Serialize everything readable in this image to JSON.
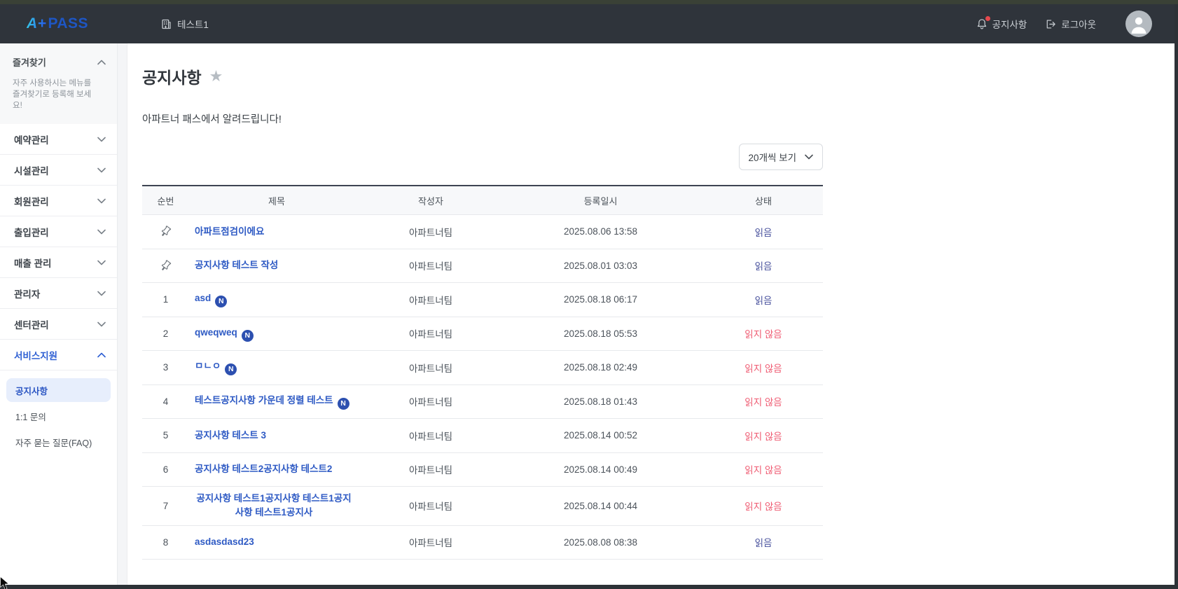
{
  "topbar": {
    "logo_a": "A+",
    "logo_pass": "PASS",
    "site_tab": "테스트1",
    "notice_label": "공지사항",
    "logout_label": "로그아웃"
  },
  "sidebar": {
    "favorites": {
      "title": "즐겨찾기",
      "description": "자주 사용하시는 메뉴를 즐겨찾기로 등록해 보세요!"
    },
    "menus": [
      {
        "label": "예약관리",
        "expanded": false
      },
      {
        "label": "시설관리",
        "expanded": false
      },
      {
        "label": "회원관리",
        "expanded": false
      },
      {
        "label": "출입관리",
        "expanded": false
      },
      {
        "label": "매출 관리",
        "expanded": false
      },
      {
        "label": "관리자",
        "expanded": false
      },
      {
        "label": "센터관리",
        "expanded": false
      },
      {
        "label": "서비스지원",
        "expanded": true
      }
    ],
    "submenu": [
      {
        "label": "공지사항",
        "active": true
      },
      {
        "label": "1:1 문의",
        "active": false
      },
      {
        "label": "자주 묻는 질문(FAQ)",
        "active": false
      }
    ]
  },
  "main": {
    "title": "공지사항",
    "subtitle": "아파트너 패스에서 알려드립니다!",
    "page_size_select": "20개씩 보기",
    "table": {
      "headers": [
        "순번",
        "제목",
        "작성자",
        "등록일시",
        "상태"
      ],
      "rows": [
        {
          "no": "",
          "pinned": true,
          "title": "아파트점검이에요",
          "new": false,
          "author": "아파트너팀",
          "date": "2025.08.06 13:58",
          "status": "읽음",
          "read": true
        },
        {
          "no": "",
          "pinned": true,
          "title": "공지사항 테스트 작성",
          "new": false,
          "author": "아파트너팀",
          "date": "2025.08.01 03:03",
          "status": "읽음",
          "read": true
        },
        {
          "no": "1",
          "pinned": false,
          "title": "asd",
          "new": true,
          "author": "아파트너팀",
          "date": "2025.08.18 06:17",
          "status": "읽음",
          "read": true
        },
        {
          "no": "2",
          "pinned": false,
          "title": "qweqweq",
          "new": true,
          "author": "아파트너팀",
          "date": "2025.08.18 05:53",
          "status": "읽지 않음",
          "read": false
        },
        {
          "no": "3",
          "pinned": false,
          "title": "ㅁㄴㅇ",
          "new": true,
          "author": "아파트너팀",
          "date": "2025.08.18 02:49",
          "status": "읽지 않음",
          "read": false
        },
        {
          "no": "4",
          "pinned": false,
          "title": "테스트공지사항 가운데 정렬 테스트",
          "new": true,
          "author": "아파트너팀",
          "date": "2025.08.18 01:43",
          "status": "읽지 않음",
          "read": false
        },
        {
          "no": "5",
          "pinned": false,
          "title": "공지사항 테스트 3",
          "new": false,
          "author": "아파트너팀",
          "date": "2025.08.14 00:52",
          "status": "읽지 않음",
          "read": false
        },
        {
          "no": "6",
          "pinned": false,
          "title": "공지사항 테스트2공지사항 테스트2",
          "new": false,
          "author": "아파트너팀",
          "date": "2025.08.14 00:49",
          "status": "읽지 않음",
          "read": false
        },
        {
          "no": "7",
          "pinned": false,
          "title": "공지사항 테스트1공지사항 테스트1공지사항 테스트1공지사",
          "new": false,
          "author": "아파트너팀",
          "date": "2025.08.14 00:44",
          "status": "읽지 않음",
          "read": false
        },
        {
          "no": "8",
          "pinned": false,
          "title": "asdasdasd23",
          "new": false,
          "author": "아파트너팀",
          "date": "2025.08.08 08:38",
          "status": "읽음",
          "read": true
        }
      ]
    }
  },
  "colors": {
    "topbar_bg": "#2f343b",
    "accent_link": "#2e5ac4",
    "active_menu": "#2e5fd3",
    "active_pill_bg": "#e7eefc",
    "read_status": "#47509c",
    "unread_status": "#ef5b72",
    "new_badge_bg": "#2d50b0",
    "notification_dot": "#e5484d"
  }
}
